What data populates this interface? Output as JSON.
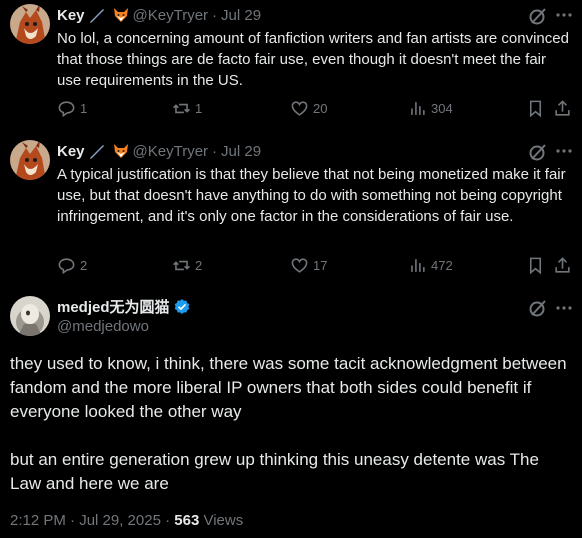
{
  "replies": [
    {
      "display_name": "Key",
      "handle": "@KeyTryer",
      "separator": "·",
      "date": "Jul 29",
      "text": "No lol, a concerning amount of fanfiction writers and fan artists are convinced that those things are de facto fair use, even though it doesn't meet the fair use requirements in the US.",
      "replies": "1",
      "retweets": "1",
      "likes": "20",
      "views": "304"
    },
    {
      "display_name": "Key",
      "handle": "@KeyTryer",
      "separator": "·",
      "date": "Jul 29",
      "text": "A typical justification is that they believe that not being monetized make it fair use, but that doesn't have anything to do with something not being copyright infringement, and it's only one factor in the considerations of fair use.",
      "replies": "2",
      "retweets": "2",
      "likes": "17",
      "views": "472"
    }
  ],
  "main_tweet": {
    "display_name": "medjed无为圆猫",
    "handle": "@medjedowo",
    "paragraph_1": "they used to know, i think, there was some tacit acknowledgment between fandom and the more liberal IP owners that both sides could benefit if everyone looked the other way",
    "paragraph_2": "but an entire generation grew up thinking this uneasy detente was The Law and here we are",
    "timestamp": "2:12 PM · Jul 29, 2025 · ",
    "views_count": "563",
    "views_label": " Views"
  },
  "colors": {
    "background": "#000000",
    "text": "#e7e9ea",
    "muted": "#71767b",
    "verified": "#1d9bf0",
    "divider": "#2f3336"
  },
  "icons": [
    "pen-icon",
    "fox-icon",
    "grok-icon",
    "more-icon",
    "reply-icon",
    "retweet-icon",
    "like-icon",
    "views-icon",
    "bookmark-icon",
    "share-icon",
    "verified-badge-icon"
  ]
}
